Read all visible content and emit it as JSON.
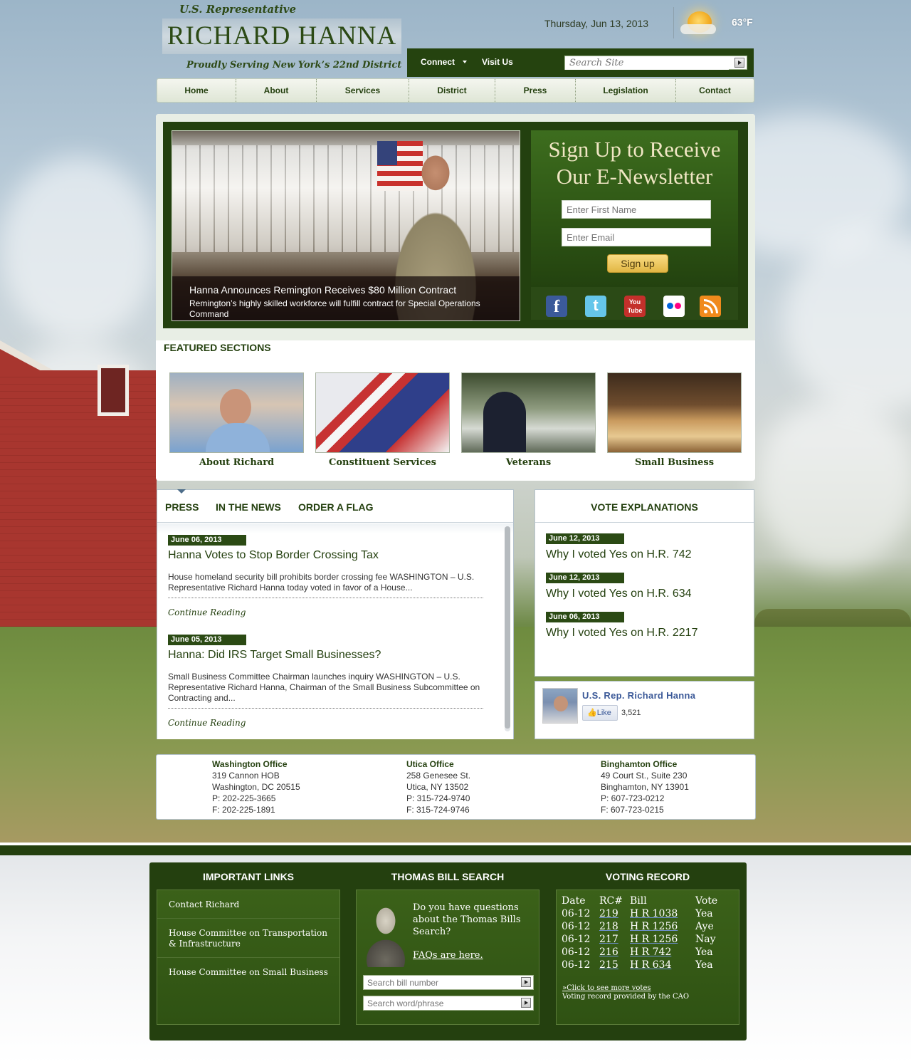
{
  "header": {
    "subtitle": "U.S. Representative",
    "name": "RICHARD HANNA",
    "tagline": "Proudly Serving New York’s 22nd District",
    "date": "Thursday, Jun 13, 2013",
    "temperature": "63°F",
    "weather_icon": "sun-partly-cloudy-icon"
  },
  "utility": {
    "connect": "Connect",
    "visit": "Visit Us",
    "search_placeholder": "Search Site"
  },
  "nav": [
    "Home",
    "About",
    "Services",
    "District",
    "Press",
    "Legislation",
    "Contact"
  ],
  "hero": {
    "title": "Hanna Announces Remington Receives $80 Million Contract",
    "body": "Remington’s highly skilled workforce will fulfill contract for Special Operations Command"
  },
  "signup": {
    "title_line1": "Sign Up to Receive",
    "title_line2": "Our E-Newsletter",
    "first_name_placeholder": "Enter First Name",
    "email_placeholder": "Enter Email",
    "button": "Sign up"
  },
  "social": [
    {
      "name": "facebook-icon",
      "glyph": "f",
      "color": "#3b5a9a"
    },
    {
      "name": "twitter-icon",
      "glyph": "t",
      "color": "#49b6e2"
    },
    {
      "name": "youtube-icon",
      "glyph": "You Tube",
      "color": "#c4302b"
    },
    {
      "name": "flickr-icon",
      "glyph": "●●",
      "color": "#ffffff"
    },
    {
      "name": "rss-icon",
      "glyph": "))",
      "color": "#f08a1c"
    }
  ],
  "featured": {
    "label": "FEATURED SECTIONS",
    "items": [
      "About Richard",
      "Constituent Services",
      "Veterans",
      "Small Business"
    ]
  },
  "news": {
    "tabs": [
      "PRESS",
      "IN THE NEWS",
      "ORDER A FLAG"
    ],
    "articles": [
      {
        "date": "June 06, 2013",
        "title": "Hanna Votes to Stop Border Crossing Tax",
        "body": "House homeland security bill prohibits border crossing fee WASHINGTON – U.S. Representative Richard Hanna today voted in favor of a House...",
        "more": "Continue Reading"
      },
      {
        "date": "June 05, 2013",
        "title": "Hanna: Did IRS Target Small Businesses?",
        "body": "Small Business Committee Chairman launches inquiry WASHINGTON – U.S. Representative Richard Hanna, Chairman of the Small Business Subcommittee on Contracting and...",
        "more": "Continue Reading"
      }
    ]
  },
  "votes": {
    "title": "VOTE EXPLANATIONS",
    "items": [
      {
        "date": "June 12, 2013",
        "title": "Why I voted Yes on H.R. 742"
      },
      {
        "date": "June 12, 2013",
        "title": "Why I voted Yes on H.R. 634"
      },
      {
        "date": "June 06, 2013",
        "title": "Why I voted Yes on H.R. 2217"
      }
    ]
  },
  "facebook": {
    "name": "U.S. Rep. Richard Hanna",
    "like": "Like",
    "count": "3,521"
  },
  "offices": [
    {
      "name": "Washington Office",
      "lines": [
        "319 Cannon HOB",
        "Washington, DC 20515",
        "P: 202-225-3665",
        "F: 202-225-1891"
      ]
    },
    {
      "name": "Utica Office",
      "lines": [
        "258 Genesee St.",
        "Utica, NY 13502",
        "P: 315-724-9740",
        "F: 315-724-9746"
      ]
    },
    {
      "name": "Binghamton Office",
      "lines": [
        "49 Court St., Suite 230",
        "Binghamton, NY 13901",
        "P: 607-723-0212",
        "F: 607-723-0215"
      ]
    }
  ],
  "footer": {
    "links_title": "IMPORTANT LINKS",
    "links": [
      "Contact Richard",
      "House Committee on Transportation & Infrastructure",
      "House Committee on Small Business"
    ],
    "thomas_title": "THOMAS BILL SEARCH",
    "thomas_question": "Do you have questions about the Thomas Bills Search?",
    "thomas_faq": "FAQs are here.",
    "bill_number_placeholder": "Search bill number",
    "word_phrase_placeholder": "Search word/phrase",
    "record_title": "VOTING RECORD",
    "record_headers": [
      "Date",
      "RC#",
      "Bill",
      "Vote"
    ],
    "record_rows": [
      [
        "06-12",
        "219",
        "H R 1038",
        "Yea"
      ],
      [
        "06-12",
        "218",
        "H R 1256",
        "Aye"
      ],
      [
        "06-12",
        "217",
        "H R 1256",
        "Nay"
      ],
      [
        "06-12",
        "216",
        "H R 742",
        "Yea"
      ],
      [
        "06-12",
        "215",
        "H R 634",
        "Yea"
      ]
    ],
    "more_votes": "»Click to see more votes",
    "provided_by": "Voting record provided by the CAO"
  }
}
